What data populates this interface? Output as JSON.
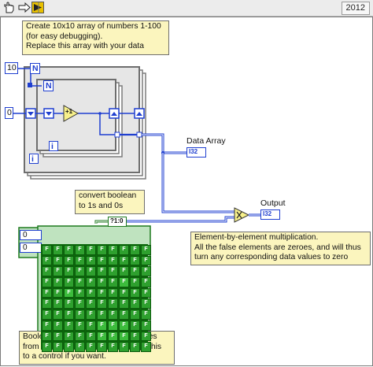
{
  "toolbar": {
    "buttons": [
      {
        "icon": "hand-pointer-icon"
      },
      {
        "icon": "arrow-right-icon"
      },
      {
        "icon": "run-arrow-icon"
      }
    ],
    "version": "2012"
  },
  "notes": {
    "create_array": "Create 10x10 array of numbers 1-100\n(for easy debugging).\nReplace this array with your data",
    "convert_boolean": "convert boolean\nto 1s and 0s",
    "multiplication": "Element-by-element multiplication.\nAll the false elements are zeroes, and will thus\nturn any corresponding data values to zero",
    "boolean_constant": "Boolean constant for selecting values\nfrom the array graphically. Change this\nto a control if you want."
  },
  "constants": {
    "loop_count": "10",
    "initial_value": "0",
    "outer_loop_n": "N",
    "inner_loop_n": "N",
    "inner_loop_i": "i",
    "outer_loop_i": "i",
    "increment": "+1"
  },
  "indicators": {
    "data_array": {
      "label": "Data Array",
      "type": "I32"
    },
    "output": {
      "label": "Output",
      "type": "I32"
    }
  },
  "bool_to_num": "?1:0",
  "boolean_array": {
    "index_row": "0",
    "index_col": "0",
    "cell_text": "F",
    "true_cells": [
      [
        7,
        5
      ],
      [
        7,
        6
      ],
      [
        7,
        7
      ],
      [
        8,
        5
      ],
      [
        8,
        6
      ],
      [
        8,
        7
      ],
      [
        3,
        7
      ],
      [
        4,
        2
      ]
    ]
  },
  "colors": {
    "numeric_wire": "#1f3fd0",
    "boolean_wire": "#1f7a1f",
    "comment_bg": "#fbf5be"
  }
}
